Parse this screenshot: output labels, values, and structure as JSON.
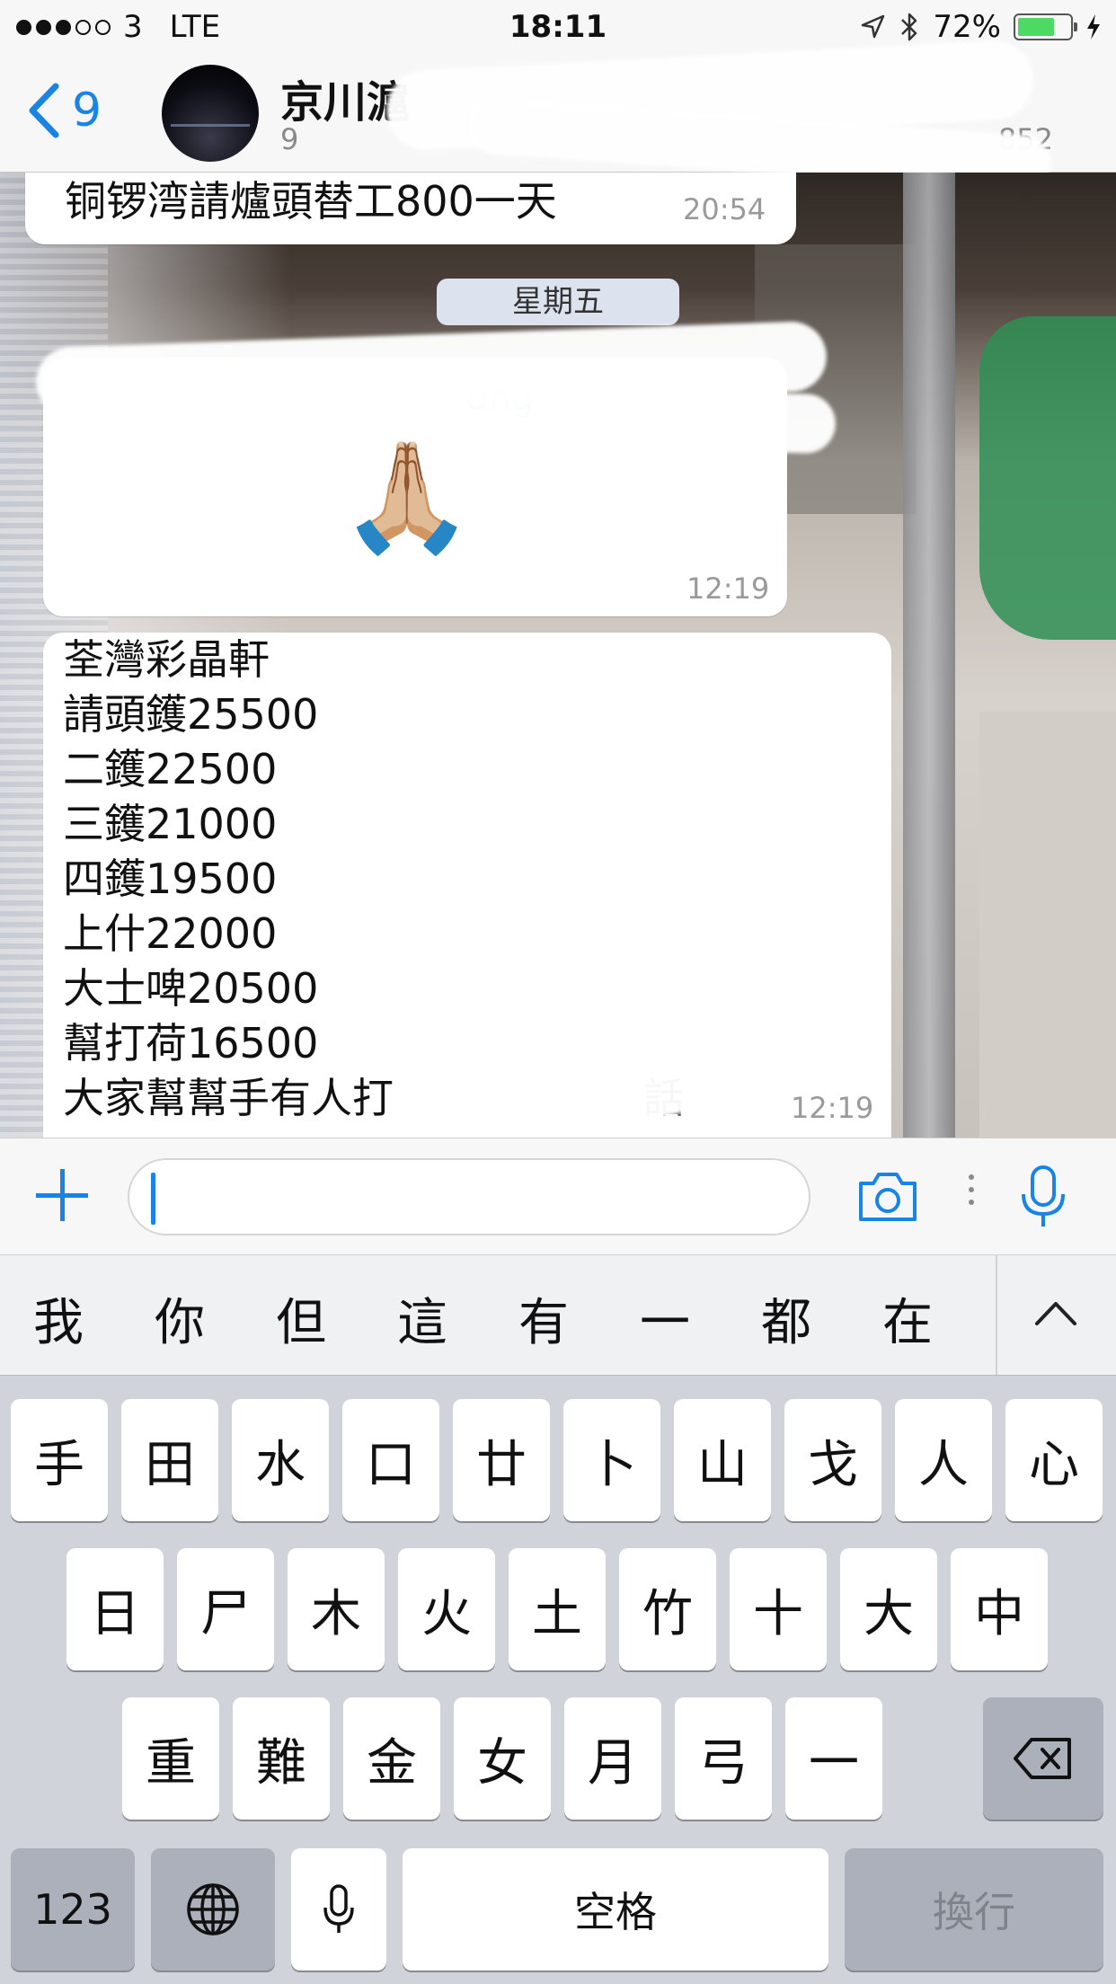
{
  "status_bar": {
    "carrier": "3",
    "network": "LTE",
    "time": "18:11",
    "battery_percent": "72%",
    "battery_level": 0.72
  },
  "header": {
    "back_count": "9",
    "contact_name": "京川滬",
    "subtitle_left": "9",
    "subtitle_right": "852"
  },
  "messages": [
    {
      "text": "铜锣湾請爐頭替工800一天",
      "time": "20:54"
    },
    {
      "date_separator": "星期五"
    },
    {
      "sender_fragment": "ung",
      "emoji": "🙏🏼",
      "time": "12:19"
    },
    {
      "lines": "荃灣彩晶軒\n請頭鑊25500\n二鑊22500\n三鑊21000\n四鑊19500\n上什22000\n大士啤20500\n幫打荷16500\n大家幫幫手有人打",
      "trailing": "話",
      "time": "12:19"
    }
  ],
  "input": {
    "value": "",
    "placeholder": ""
  },
  "candidates": [
    "我",
    "你",
    "但",
    "這",
    "有",
    "一",
    "都",
    "在"
  ],
  "keyboard": {
    "row1": [
      "手",
      "田",
      "水",
      "口",
      "廿",
      "卜",
      "山",
      "戈",
      "人",
      "心"
    ],
    "row2": [
      "日",
      "尸",
      "木",
      "火",
      "土",
      "竹",
      "十",
      "大",
      "中"
    ],
    "row3": [
      "重",
      "難",
      "金",
      "女",
      "月",
      "弓",
      "一"
    ],
    "numbers_label": "123",
    "space_label": "空格",
    "return_label": "換行"
  },
  "colors": {
    "accent": "#1a84e6",
    "battery_green": "#4cd964",
    "bubble": "#ffffff",
    "keyboard_bg": "#d0d3d9",
    "dark_key": "#abb0ba"
  }
}
